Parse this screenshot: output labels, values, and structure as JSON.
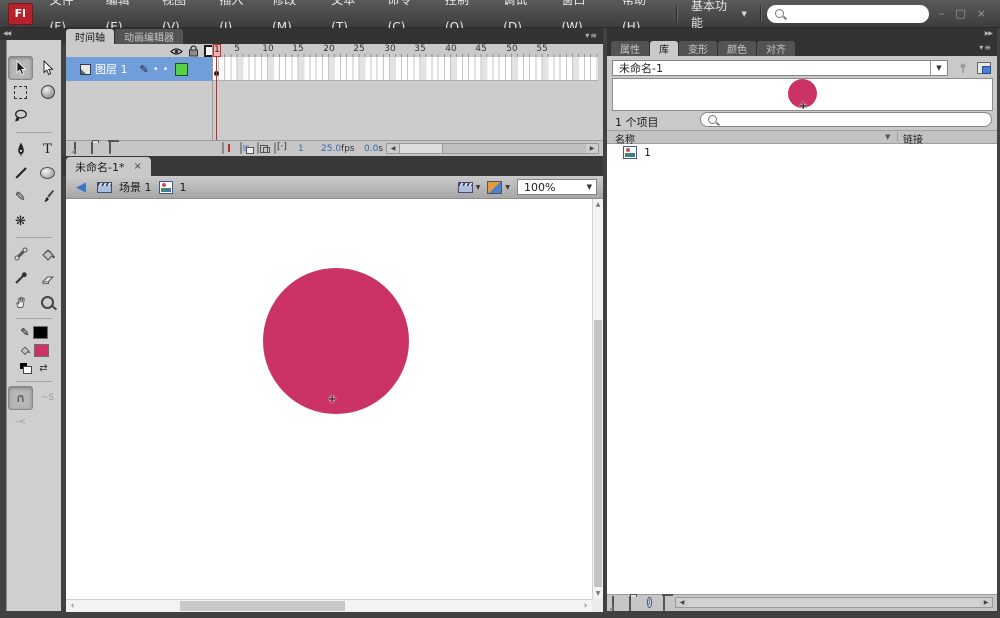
{
  "colors": {
    "accent_pink": "#cb3366",
    "layer_selected_blue": "#6f9edb",
    "keyframe_green": "#54d243",
    "playhead_red": "#c22b2b",
    "panel_gray": "#c9c9c9",
    "chrome_dark": "#3a3a3a"
  },
  "window": {
    "logo": "Fl",
    "minimize": "–",
    "maximize": "□",
    "close": "×"
  },
  "menu_bar": {
    "items": [
      "文件(F)",
      "编辑(E)",
      "视图(V)",
      "插入(I)",
      "修改(M)",
      "文本(T)",
      "命令(C)",
      "控制(O)",
      "调试(D)",
      "窗口(W)",
      "帮助(H)"
    ],
    "workspace_switcher": "基本功能",
    "search_value": ""
  },
  "toolbar": {
    "text_tool_glyph": "T",
    "pencil_glyph": "✎",
    "deco_glyph": "❋",
    "magnet_glyph": "∩",
    "smooth_glyph": "~S",
    "straighten_glyph": "-<",
    "stroke_color": "#000000",
    "fill_color": "#cb3365"
  },
  "timeline": {
    "tab_timeline": "时间轴",
    "tab_motion_editor": "动画编辑器",
    "layer_name": "图层 1",
    "ruler": [
      "1",
      "5",
      "10",
      "15",
      "20",
      "25",
      "30",
      "35",
      "40",
      "45",
      "50",
      "55"
    ],
    "current_frame": "1",
    "frame_rate": "25.0",
    "frame_rate_unit": "fps",
    "elapsed_time": "0.0",
    "elapsed_time_unit": "s"
  },
  "document": {
    "tab_title": "未命名-1*",
    "close": "×",
    "scene": "场景 1",
    "symbol": "1",
    "zoom_level": "100%"
  },
  "stage": {
    "circle_color": "#cb3366"
  },
  "right_panel": {
    "tabs": [
      "属性",
      "库",
      "变形",
      "颜色",
      "对齐"
    ],
    "library": {
      "document_name": "未命名-1",
      "item_count": "1 个项目",
      "column_name": "名称",
      "column_linkage": "链接",
      "item_name": "1",
      "search_value": ""
    }
  },
  "icons": {
    "collapse_left": "◀◀",
    "collapse_right": "▶▶",
    "panel_menu": "▾≡",
    "dropdown_caret": "▼",
    "back_arrow": "◀",
    "sort_caret": "▼",
    "scroll_left": "◀",
    "scroll_right": "▶",
    "scroll_up": "▲",
    "scroll_down": "▼",
    "stage_scroll_left": "‹",
    "stage_scroll_right": "›",
    "bullet": "•",
    "swap": "⇄",
    "reg_point": "+"
  }
}
